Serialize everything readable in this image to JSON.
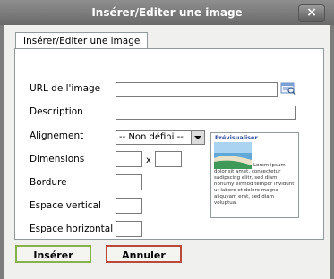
{
  "dialog": {
    "title": "Insérer/Editer une image",
    "close_label": "×"
  },
  "tab": {
    "label": "Insérer/Editer une image"
  },
  "form": {
    "url_label": "URL de l'image",
    "url_value": "",
    "description_label": "Description",
    "description_value": "",
    "alignment_label": "Alignement",
    "alignment_value": "-- Non défini --",
    "dimensions_label": "Dimensions",
    "dimensions_separator": "x",
    "width_value": "",
    "height_value": "",
    "border_label": "Bordure",
    "border_value": "",
    "vspace_label": "Espace vertical",
    "vspace_value": "",
    "hspace_label": "Espace horizontal",
    "hspace_value": ""
  },
  "preview": {
    "title": "Prévisualiser",
    "text": "Lorem ipsum dolor sit amet, consectetur sadipscing elitr, sed diam nonumy eirmod tempor invidunt ut labore et dolore magna aliquyam erat, sed diam voluptua."
  },
  "buttons": {
    "insert": "Insérer",
    "cancel": "Annuler"
  },
  "icons": {
    "browse": "browse-icon",
    "close": "close-icon"
  }
}
